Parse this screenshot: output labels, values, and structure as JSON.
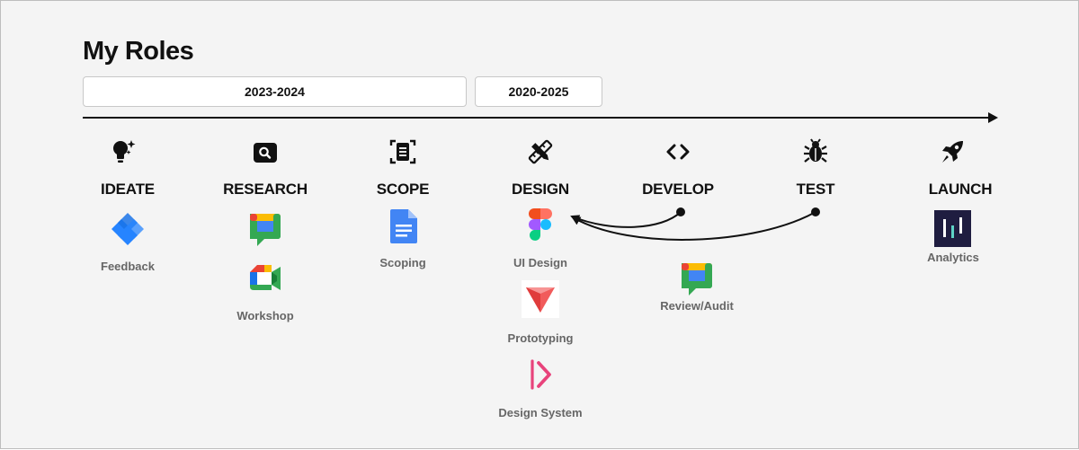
{
  "page": {
    "title": "My Roles"
  },
  "ranges": [
    {
      "label": "2023-2024"
    },
    {
      "label": "2020-2025"
    }
  ],
  "stages": [
    {
      "label": "IDEATE",
      "icon": "lightbulb-sparkle-icon",
      "tools": [
        {
          "label": "Feedback",
          "icon": "jira-icon"
        }
      ]
    },
    {
      "label": "RESEARCH",
      "icon": "magnifier-box-icon",
      "tools": [
        {
          "label": "",
          "icon": "google-chat-icon"
        },
        {
          "label": "Workshop",
          "icon": "google-meet-icon"
        }
      ]
    },
    {
      "label": "SCOPE",
      "icon": "document-frame-icon",
      "tools": [
        {
          "label": "Scoping",
          "icon": "google-docs-icon"
        }
      ]
    },
    {
      "label": "DESIGN",
      "icon": "pencil-ruler-icon",
      "tools": [
        {
          "label": "UI Design",
          "icon": "figma-icon"
        },
        {
          "label": "Prototyping",
          "icon": "protopie-icon"
        },
        {
          "label": "Design System",
          "icon": "zeroheight-icon"
        }
      ]
    },
    {
      "label": "DEVELOP",
      "icon": "code-brackets-icon",
      "tools": [
        {
          "label": "Review/Audit",
          "icon": "google-chat-icon"
        }
      ]
    },
    {
      "label": "TEST",
      "icon": "bug-icon",
      "tools": []
    },
    {
      "label": "LAUNCH",
      "icon": "rocket-icon",
      "tools": [
        {
          "label": "Analytics",
          "icon": "analytics-bars-icon"
        }
      ]
    }
  ],
  "colors": {
    "text_primary": "#111111",
    "text_secondary": "#666666",
    "google_blue": "#4285F4",
    "google_green": "#34A853",
    "google_yellow": "#FBBC04",
    "google_red": "#EA4335",
    "jira_blue": "#2684FF",
    "protopie_red": "#F15B5B",
    "zeroheight_pink": "#E8437B",
    "analytics_navy": "#1F1D40",
    "analytics_teal": "#5ED3C6"
  }
}
